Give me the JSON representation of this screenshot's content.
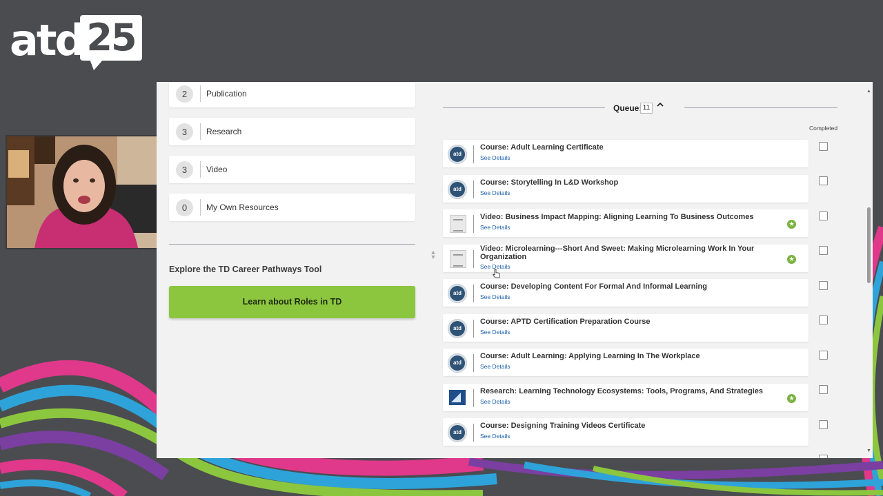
{
  "logo": {
    "brand": "atd",
    "year": "25"
  },
  "resource_list": [
    {
      "count": "2",
      "label": "Publication"
    },
    {
      "count": "3",
      "label": "Research"
    },
    {
      "count": "3",
      "label": "Video"
    },
    {
      "count": "0",
      "label": "My Own Resources"
    }
  ],
  "explore": {
    "title": "Explore the TD Career Pathways Tool",
    "button_label": "Learn about Roles in TD"
  },
  "queue": {
    "label": "Queue:",
    "count": "11",
    "toggle_icon": "chevron-up-icon",
    "completed_header": "Completed",
    "items": [
      {
        "icon": "course",
        "title": "Course: Adult Learning Certificate",
        "details": "See Details",
        "starred": false
      },
      {
        "icon": "course",
        "title": "Course: Storytelling In L&D Workshop",
        "details": "See Details",
        "starred": false
      },
      {
        "icon": "video",
        "title": "Video: Business Impact Mapping: Aligning Learning To Business Outcomes",
        "details": "See Details",
        "starred": true
      },
      {
        "icon": "video",
        "title": "Video: Microlearning---Short And Sweet: Making Microlearning Work In Your Organization",
        "details": "See Details",
        "starred": true
      },
      {
        "icon": "course",
        "title": "Course: Developing Content For Formal And Informal Learning",
        "details": "See Details",
        "starred": false
      },
      {
        "icon": "course",
        "title": "Course: APTD Certification Preparation Course",
        "details": "See Details",
        "starred": false
      },
      {
        "icon": "course",
        "title": "Course: Adult Learning: Applying Learning In The Workplace",
        "details": "See Details",
        "starred": false
      },
      {
        "icon": "research",
        "title": "Research: Learning Technology Ecosystems: Tools, Programs, And Strategies",
        "details": "See Details",
        "starred": true
      },
      {
        "icon": "course",
        "title": "Course: Designing Training Videos Certificate",
        "details": "See Details",
        "starred": false
      }
    ]
  },
  "colors": {
    "background": "#4a4c50",
    "accent_green": "#8cc63f",
    "star_green": "#7cb342",
    "link_blue": "#1a5fa8"
  }
}
